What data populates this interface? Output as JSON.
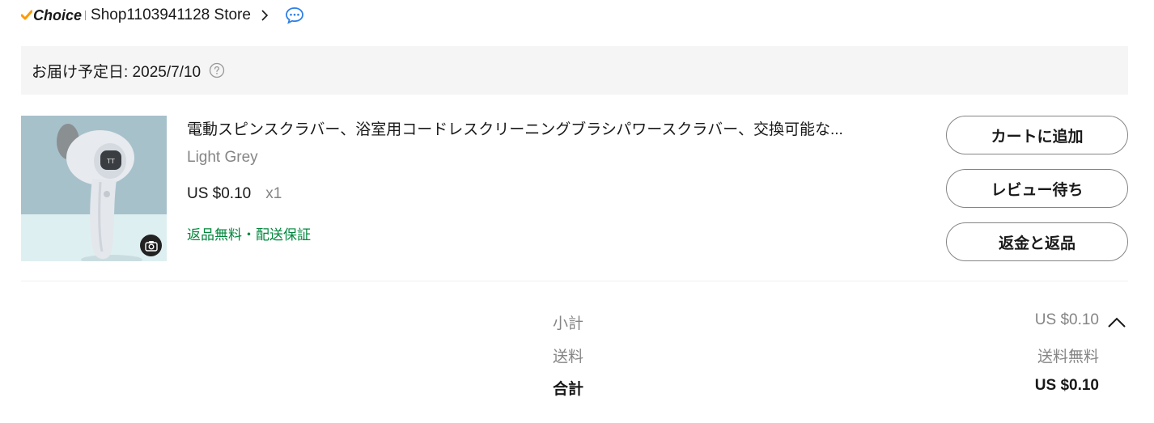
{
  "store": {
    "choice_label": "Choice",
    "name": "Shop1103941128 Store"
  },
  "delivery": {
    "text": "お届け予定日: 2025/7/10"
  },
  "product": {
    "title": "電動スピンスクラバー、浴室用コードレスクリーニングブラシパワースクラバー、交換可能な...",
    "variant": "Light Grey",
    "price": "US $0.10",
    "quantity": "x1",
    "service": "返品無料・配送保証"
  },
  "actions": {
    "add_to_cart": "カートに追加",
    "awaiting_review": "レビュー待ち",
    "refund_return": "返金と返品"
  },
  "summary": {
    "subtotal_label": "小計",
    "subtotal_value": "US $0.10",
    "shipping_label": "送料",
    "shipping_value": "送料無料",
    "total_label": "合計",
    "total_value": "US $0.10"
  },
  "colors": {
    "choice_check": "#ff9a00",
    "chat_icon": "#2d7fe6",
    "service_green": "#00873c",
    "delivery_bg": "#f5f5f5"
  }
}
